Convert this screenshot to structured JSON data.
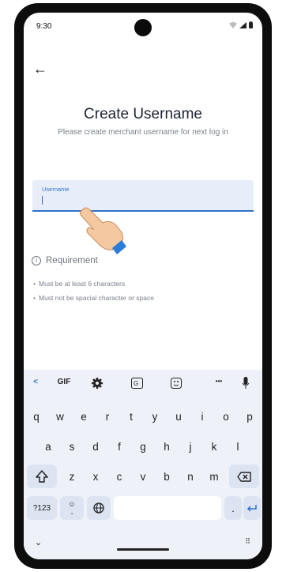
{
  "status_bar": {
    "time": "9:30"
  },
  "header": {
    "back_icon": "arrow-left-icon",
    "back_glyph": "←"
  },
  "page": {
    "title": "Create Username",
    "subtitle": "Please create merchant username for next log in"
  },
  "form": {
    "username_label": "Username",
    "username_value": ""
  },
  "requirements": {
    "heading": "Requirement",
    "items": [
      "Must be at least 6 characters",
      "Must not be spacial character or space"
    ]
  },
  "keyboard": {
    "toolbar": {
      "back": "<",
      "gif": "GIF",
      "more": "•••"
    },
    "row1": [
      "q",
      "w",
      "e",
      "r",
      "t",
      "y",
      "u",
      "i",
      "o",
      "p"
    ],
    "row2": [
      "a",
      "s",
      "d",
      "f",
      "g",
      "h",
      "j",
      "k",
      "l"
    ],
    "row3": [
      "z",
      "x",
      "c",
      "v",
      "b",
      "n",
      "m"
    ],
    "symbols_key": "?123",
    "emoji_comma_key": "☺\n,",
    "period_key": ".",
    "enter_icon": "enter-icon",
    "backspace_icon": "backspace-icon",
    "shift_icon": "shift-icon",
    "globe_icon": "globe-icon"
  },
  "colors": {
    "accent": "#2e72c8",
    "input_bg": "#e7eef9",
    "keyboard_bg": "#eef2f8",
    "special_key_bg": "#dce4f1"
  }
}
